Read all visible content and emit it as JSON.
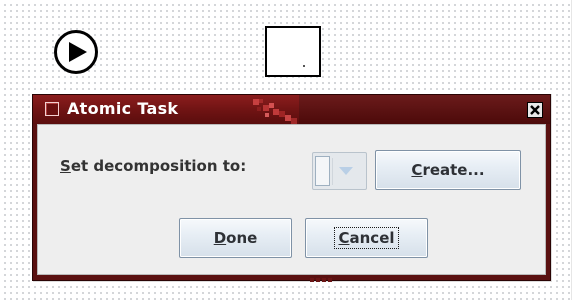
{
  "dialog": {
    "title": "Atomic Task",
    "decomposition_label": "Set decomposition to:",
    "decomposition_label_mnemonic": "S",
    "decomposition_label_rest": "et decomposition to:",
    "decomposition_value": "",
    "buttons": {
      "create": {
        "label": "Create...",
        "mnemonic": "C",
        "rest": "reate..."
      },
      "done": {
        "label": "Done",
        "mnemonic": "D",
        "rest": "one"
      },
      "cancel": {
        "label": "Cancel",
        "mnemonic": "C",
        "rest": "ancel"
      }
    }
  },
  "canvas": {
    "start_node_icon": "play-icon",
    "task_node_icon": "task-box-icon"
  },
  "colors": {
    "titlebar": "#7a1616",
    "dialog_body": "#eeeeee",
    "button_gradient_top": "#f6f9fc",
    "button_gradient_bottom": "#d6e0ea",
    "canvas_dots": "#c5c9cc"
  },
  "icons": {
    "title": "window-icon",
    "close": "close-icon",
    "combo_arrow": "chevron-down-icon"
  }
}
